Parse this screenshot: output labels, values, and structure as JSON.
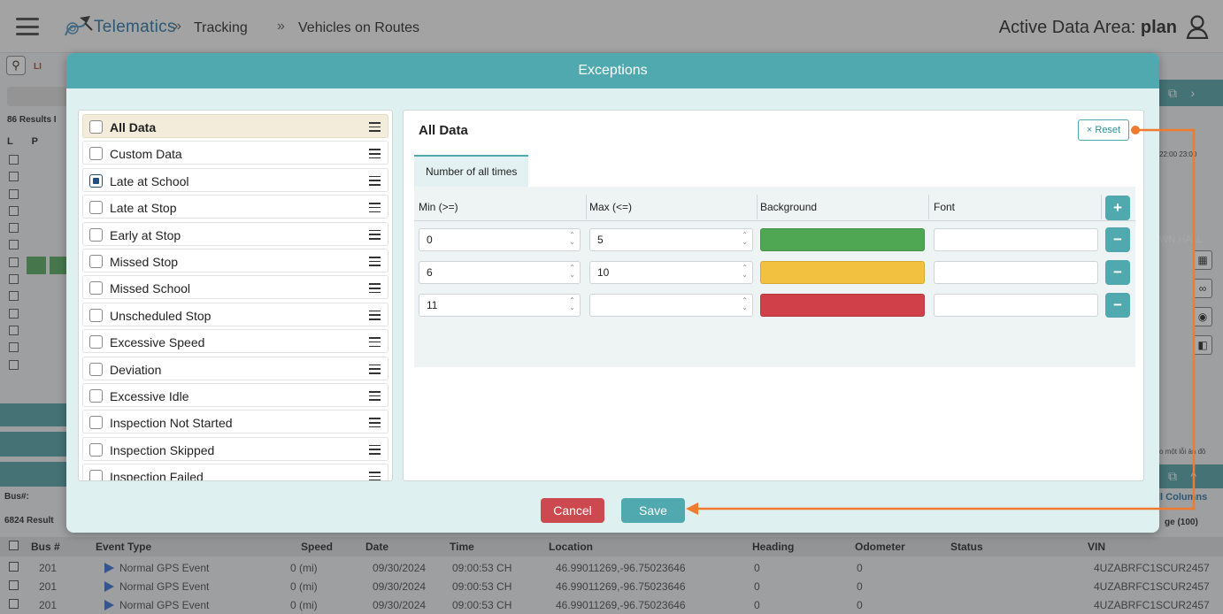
{
  "header": {
    "brand": "Telematics",
    "breadcrumb": [
      "Tracking",
      "Vehicles on Routes"
    ],
    "breadcrumb_separator": "»",
    "active_area_label": "Active Data Area:",
    "active_area_value": "plan"
  },
  "background": {
    "li_label": "LI",
    "results_label": "86 Results I",
    "col_letters": "L P",
    "bus_filter": "Bus#:",
    "result_count": "6824 Result",
    "right_times": "22:00 23:00",
    "right_hall": "WN HALL",
    "right_note": "o một lỗi ản đồ",
    "all_columns": "ll Columns",
    "page_size": "ge (100)",
    "table": {
      "columns": [
        "Bus #",
        "Event Type",
        "Speed",
        "Date",
        "Time",
        "Location",
        "Heading",
        "Odometer",
        "Status",
        "VIN"
      ],
      "rows": [
        {
          "bus": "201",
          "event": "Normal GPS Event",
          "speed": "0 (mi)",
          "date": "09/30/2024",
          "time": "09:00:53 CH",
          "location": "46.99011269,-96.75023646",
          "heading": "0",
          "odometer": "0",
          "status": "",
          "vin": "4UZABRFC1SCUR2457"
        },
        {
          "bus": "201",
          "event": "Normal GPS Event",
          "speed": "0 (mi)",
          "date": "09/30/2024",
          "time": "09:00:53 CH",
          "location": "46.99011269,-96.75023646",
          "heading": "0",
          "odometer": "0",
          "status": "",
          "vin": "4UZABRFC1SCUR2457"
        },
        {
          "bus": "201",
          "event": "Normal GPS Event",
          "speed": "0 (mi)",
          "date": "09/30/2024",
          "time": "09:00:53 CH",
          "location": "46.99011269,-96.75023646",
          "heading": "0",
          "odometer": "0",
          "status": "",
          "vin": "4UZABRFC1SCUR2457"
        }
      ]
    }
  },
  "modal": {
    "title": "Exceptions",
    "list": [
      {
        "label": "All Data",
        "checked": false,
        "active": true
      },
      {
        "label": "Custom Data",
        "checked": false,
        "active": false
      },
      {
        "label": "Late at School",
        "checked": true,
        "active": false
      },
      {
        "label": "Late at Stop",
        "checked": false,
        "active": false
      },
      {
        "label": "Early at Stop",
        "checked": false,
        "active": false
      },
      {
        "label": "Missed Stop",
        "checked": false,
        "active": false
      },
      {
        "label": "Missed School",
        "checked": false,
        "active": false
      },
      {
        "label": "Unscheduled Stop",
        "checked": false,
        "active": false
      },
      {
        "label": "Excessive Speed",
        "checked": false,
        "active": false
      },
      {
        "label": "Deviation",
        "checked": false,
        "active": false
      },
      {
        "label": "Excessive Idle",
        "checked": false,
        "active": false
      },
      {
        "label": "Inspection Not Started",
        "checked": false,
        "active": false
      },
      {
        "label": "Inspection Skipped",
        "checked": false,
        "active": false
      },
      {
        "label": "Inspection Failed",
        "checked": false,
        "active": false
      }
    ],
    "detail": {
      "title": "All Data",
      "reset_label": "× Reset",
      "tab_label": "Number of all times",
      "columns": {
        "min": "Min (>=)",
        "max": "Max (<=)",
        "background": "Background",
        "font": "Font"
      },
      "rows": [
        {
          "min": "0",
          "max": "5",
          "background": "#4fa653",
          "font": ""
        },
        {
          "min": "6",
          "max": "10",
          "background": "#f2c140",
          "font": ""
        },
        {
          "min": "11",
          "max": "",
          "background": "#cf4048",
          "font": ""
        }
      ],
      "add_label": "+",
      "remove_label": "−"
    },
    "cancel_label": "Cancel",
    "save_label": "Save"
  },
  "colors": {
    "accent": "#4fa9ae",
    "cancel": "#cc4a4f",
    "annotation": "#f07b2f"
  }
}
